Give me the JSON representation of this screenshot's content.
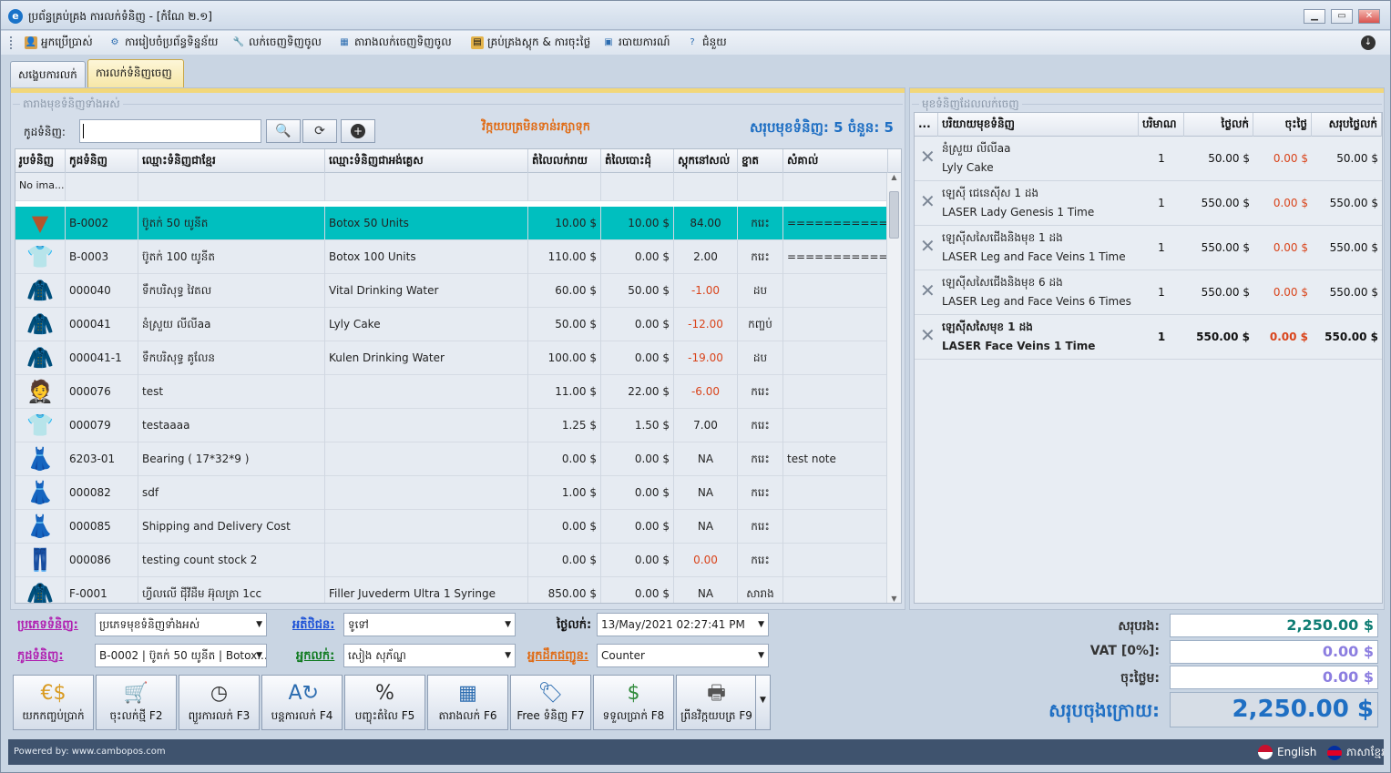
{
  "window": {
    "title": "ប្រព័ន្ធគ្រប់គ្រង ការលក់ទំនិញ - [កំណែ ២.១]"
  },
  "menu": [
    {
      "label": "អ្នកប្រើប្រាស់",
      "icon": "user-icon"
    },
    {
      "label": "ការរៀបចំប្រព័ន្ធទិន្នន័យ",
      "icon": "gear-icon"
    },
    {
      "label": "លក់ចេញទិញចូល",
      "icon": "wrench-icon"
    },
    {
      "label": "តារាងលក់ចេញទិញចូល",
      "icon": "table-icon"
    },
    {
      "label": "គ្រប់គ្រងស្តុក & ការចុះថ្លៃ",
      "icon": "folder-icon"
    },
    {
      "label": "របាយការណ៍",
      "icon": "report-icon"
    },
    {
      "label": "ជំនួយ",
      "icon": "help-icon"
    }
  ],
  "tabs": [
    "សង្ខេបការលក់",
    "ការលក់ទំនិញចេញ"
  ],
  "products_panel": {
    "legend": "តារាងមុខទំនិញទាំងអស់",
    "code_label": "កូដទំនិញ:",
    "warning": "វិក្កយបត្រមិនទាន់រក្សាទុក",
    "total_label": "សរុបមុខទំនិញ: 5 ចំនួន: 5",
    "columns": [
      "រូបទំនិញ",
      "កូដទំនិញ",
      "ឈ្មោះទំនិញជាខ្មែរ",
      "ឈ្មោះទំនិញជាអង់គ្លេស",
      "តំលៃលក់រាយ",
      "តំលៃបោះដុំ",
      "ស្តុកនៅសល់",
      "ខ្នាត",
      "សំគាល់"
    ],
    "rows": [
      {
        "img": "No ima...",
        "code": "",
        "kh": "",
        "en": "",
        "retail": "",
        "whole": "",
        "stock": "",
        "unit": "",
        "note": "",
        "icon": "none"
      },
      {
        "img": "",
        "code": "B-0002",
        "kh": "ប៊ូតក់ 50 យូនីត",
        "en": "Botox 50 Units",
        "retail": "10.00 $",
        "whole": "10.00 $",
        "stock": "84.00",
        "unit": "ករេះ",
        "note": "===============...",
        "icon": "skirt-icon",
        "sel": true
      },
      {
        "img": "",
        "code": "B-0003",
        "kh": "ប៊ូតក់ 100 យូនីត",
        "en": "Botox 100 Units",
        "retail": "110.00 $",
        "whole": "0.00 $",
        "stock": "2.00",
        "unit": "ករេះ",
        "note": "===============...",
        "icon": "tshirt-icon"
      },
      {
        "img": "",
        "code": "000040",
        "kh": "ទឹកបរិសុទ្ធ វៃតល",
        "en": "Vital Drinking Water",
        "retail": "60.00 $",
        "whole": "50.00 $",
        "stock": "-1.00",
        "unit": "ដប",
        "note": "",
        "icon": "jacket-icon",
        "neg": true
      },
      {
        "img": "",
        "code": "000041",
        "kh": "នំស្រួយ លីលីaa",
        "en": "Lyly Cake",
        "retail": "50.00 $",
        "whole": "0.00 $",
        "stock": "-12.00",
        "unit": "កញ្ចប់",
        "note": "",
        "icon": "hoodie-icon",
        "neg": true
      },
      {
        "img": "",
        "code": "000041-1",
        "kh": "ទឹកបរិសុទ្ធ គូលែន",
        "en": "Kulen Drinking Water",
        "retail": "100.00 $",
        "whole": "0.00 $",
        "stock": "-19.00",
        "unit": "ដប",
        "note": "",
        "icon": "coat-icon",
        "neg": true
      },
      {
        "img": "",
        "code": "000076",
        "kh": "test",
        "en": "",
        "retail": "11.00 $",
        "whole": "22.00 $",
        "stock": "-6.00",
        "unit": "ករេះ",
        "note": "",
        "icon": "suit-icon",
        "neg": true
      },
      {
        "img": "",
        "code": "000079",
        "kh": "testaaaa",
        "en": "",
        "retail": "1.25 $",
        "whole": "1.50 $",
        "stock": "7.00",
        "unit": "ករេះ",
        "note": "",
        "icon": "shirt-icon"
      },
      {
        "img": "",
        "code": "6203-01",
        "kh": "Bearing ( 17*32*9 )",
        "en": "",
        "retail": "0.00 $",
        "whole": "0.00 $",
        "stock": "NA",
        "unit": "ករេះ",
        "note": "test note",
        "icon": "dress-icon"
      },
      {
        "img": "",
        "code": "000082",
        "kh": "sdf",
        "en": "",
        "retail": "1.00 $",
        "whole": "0.00 $",
        "stock": "NA",
        "unit": "ករេះ",
        "note": "",
        "icon": "gown-icon"
      },
      {
        "img": "",
        "code": "000085",
        "kh": "Shipping and Delivery Cost",
        "en": "",
        "retail": "0.00 $",
        "whole": "0.00 $",
        "stock": "NA",
        "unit": "ករេះ",
        "note": "",
        "icon": "red-dress-icon"
      },
      {
        "img": "",
        "code": "000086",
        "kh": "testing count stock 2",
        "en": "",
        "retail": "0.00 $",
        "whole": "0.00 $",
        "stock": "0.00",
        "unit": "ករេះ",
        "note": "",
        "icon": "pants-icon",
        "neg": true
      },
      {
        "img": "",
        "code": "F-0001",
        "kh": "ហ្វីលលើ ជុីវីដឺម អ៊ុលត្រា 1cc",
        "en": "Filler Juvederm Ultra 1 Syringe",
        "retail": "850.00 $",
        "whole": "0.00 $",
        "stock": "NA",
        "unit": "សារាង",
        "note": "",
        "icon": "blazer-icon"
      }
    ]
  },
  "cart_panel": {
    "legend": "មុខទំនិញដែលលក់ចេញ",
    "columns": [
      "...",
      "បរិយាយមុខទំនិញ",
      "បរិមាណ",
      "ថ្លៃលក់",
      "ចុះថ្លៃ",
      "សរុបថ្លៃលក់"
    ],
    "rows": [
      {
        "kh": "នំស្រួយ លីលីaa",
        "en": "Lyly Cake",
        "qty": "1",
        "price": "50.00 $",
        "disc": "0.00 $",
        "total": "50.00 $"
      },
      {
        "kh": "ឡេស៊ី ជេនេស៊ីស 1 ដង",
        "en": "LASER Lady Genesis 1 Time",
        "qty": "1",
        "price": "550.00 $",
        "disc": "0.00 $",
        "total": "550.00 $"
      },
      {
        "kh": "ឡេស៊ីសសៃជើងនិងមុខ 1 ដង",
        "en": "LASER Leg and Face Veins 1 Time",
        "qty": "1",
        "price": "550.00 $",
        "disc": "0.00 $",
        "total": "550.00 $"
      },
      {
        "kh": "ឡេស៊ីសសៃជើងនិងមុខ 6 ដង",
        "en": "LASER Leg and Face Veins 6 Times",
        "qty": "1",
        "price": "550.00 $",
        "disc": "0.00 $",
        "total": "550.00 $"
      },
      {
        "kh": "ឡេស៊ីសសៃមុខ 1 ដង",
        "en": "LASER Face Veins 1 Time",
        "qty": "1",
        "price": "550.00 $",
        "disc": "0.00 $",
        "total": "550.00 $",
        "bold": true
      }
    ]
  },
  "form": {
    "category_label": "ប្រភេទទំនិញ:",
    "category_value": "ប្រភេទមុខទំនិញទាំងអស់",
    "code_label": "កូដទំនិញ:",
    "code_value": "B-0002 | ប៊ូតក់ 50 យូនីត | Botox...",
    "customer_label": "អតិថិជន:",
    "customer_value": "ទូទៅ",
    "seller_label": "អ្នកលក់:",
    "seller_value": "សៀង សុភ័ណ្ឌ",
    "date_label": "ថ្ងៃលក់:",
    "date_value": "13/May/2021 02:27:41 PM",
    "shipper_label": "អ្នកដឹកជញ្ជូន:",
    "shipper_value": "Counter"
  },
  "buttons": [
    {
      "label": "យកកញ្ចប់ប្រាក់",
      "icon": "coins-icon"
    },
    {
      "label": "ចុះលក់ថ្មី F2",
      "icon": "cart-icon"
    },
    {
      "label": "ព្យួរការលក់ F3",
      "icon": "clock-icon"
    },
    {
      "label": "បន្តការលក់ F4",
      "icon": "refresh-az-icon"
    },
    {
      "label": "បញ្ចុះតំលៃ F5",
      "icon": "percent-icon"
    },
    {
      "label": "តារាងលក់ F6",
      "icon": "calendar-icon"
    },
    {
      "label": "Free ទំនិញ F7",
      "icon": "tag-icon"
    },
    {
      "label": "ទទួលប្រាក់ F8",
      "icon": "money-icon"
    },
    {
      "label": "ព្រីនវិក្កយបត្រ F9",
      "icon": "printer-icon"
    }
  ],
  "summary": {
    "subtotal_label": "សរុបរង:",
    "subtotal": "2,250.00 $",
    "vat_label": "VAT [0%]:",
    "vat": "0.00 $",
    "discount_label": "ចុះថ្លៃម:",
    "discount": "0.00 $",
    "grand_label": "សរុបចុងក្រោយ:",
    "grand": "2,250.00 $"
  },
  "status": {
    "powered": "Powered by: www.cambopos.com",
    "lang_en": "English",
    "lang_kh": "ភាសាខ្មែរ"
  },
  "colors": {
    "accent": "#00bfbf",
    "negative": "#d9441b",
    "warning": "#e06b14",
    "total_blue": "#1f6fc3"
  }
}
